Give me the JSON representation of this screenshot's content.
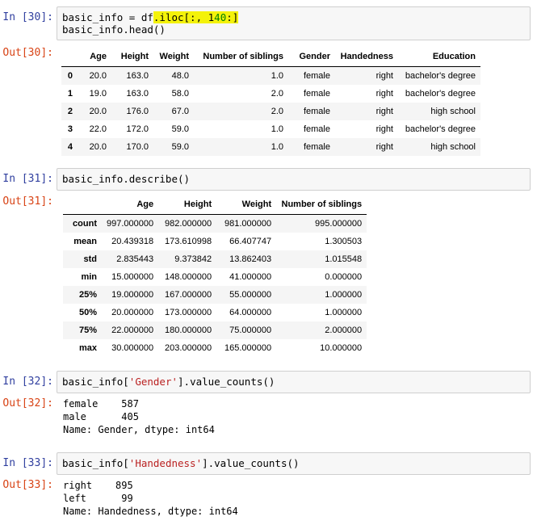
{
  "cells": [
    {
      "in_prompt": "In [30]:",
      "code_parts": [
        "basic_info = df",
        ".iloc[:, 1",
        "4",
        "0",
        ":]"
      ],
      "code_line2": "basic_info.head()",
      "out_prompt": "Out[30]:",
      "table": {
        "columns": [
          "",
          "Age",
          "Height",
          "Weight",
          "Number of siblings",
          "Gender",
          "Handedness",
          "Education"
        ],
        "rows": [
          [
            "0",
            "20.0",
            "163.0",
            "48.0",
            "1.0",
            "female",
            "right",
            "bachelor's degree"
          ],
          [
            "1",
            "19.0",
            "163.0",
            "58.0",
            "2.0",
            "female",
            "right",
            "bachelor's degree"
          ],
          [
            "2",
            "20.0",
            "176.0",
            "67.0",
            "2.0",
            "female",
            "right",
            "high school"
          ],
          [
            "3",
            "22.0",
            "172.0",
            "59.0",
            "1.0",
            "female",
            "right",
            "bachelor's degree"
          ],
          [
            "4",
            "20.0",
            "170.0",
            "59.0",
            "1.0",
            "female",
            "right",
            "high school"
          ]
        ]
      }
    },
    {
      "in_prompt": "In [31]:",
      "code": "basic_info.describe()",
      "out_prompt": "Out[31]:",
      "table": {
        "columns": [
          "",
          "Age",
          "Height",
          "Weight",
          "Number of siblings"
        ],
        "rows": [
          [
            "count",
            "997.000000",
            "982.000000",
            "981.000000",
            "995.000000"
          ],
          [
            "mean",
            "20.439318",
            "173.610998",
            "66.407747",
            "1.300503"
          ],
          [
            "std",
            "2.835443",
            "9.373842",
            "13.862403",
            "1.015548"
          ],
          [
            "min",
            "15.000000",
            "148.000000",
            "41.000000",
            "0.000000"
          ],
          [
            "25%",
            "19.000000",
            "167.000000",
            "55.000000",
            "1.000000"
          ],
          [
            "50%",
            "20.000000",
            "173.000000",
            "64.000000",
            "1.000000"
          ],
          [
            "75%",
            "22.000000",
            "180.000000",
            "75.000000",
            "2.000000"
          ],
          [
            "max",
            "30.000000",
            "203.000000",
            "165.000000",
            "10.000000"
          ]
        ]
      }
    },
    {
      "in_prompt": "In [32]:",
      "code_pre": "basic_info[",
      "code_str": "'Gender'",
      "code_post": "].value_counts()",
      "out_prompt": "Out[32]:",
      "output": "female    587\nmale      405\nName: Gender, dtype: int64"
    },
    {
      "in_prompt": "In [33]:",
      "code_pre": "basic_info[",
      "code_str": "'Handedness'",
      "code_post": "].value_counts()",
      "out_prompt": "Out[33]:",
      "output": "right    895\nleft      99\nName: Handedness, dtype: int64"
    }
  ],
  "colors": {
    "in_prompt": "#303f9f",
    "out_prompt": "#d84315",
    "highlight": "#f4f20a",
    "number": "#008000",
    "string": "#ba2121"
  }
}
